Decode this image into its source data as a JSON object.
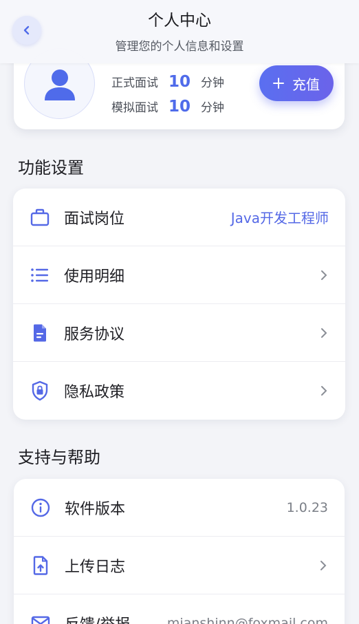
{
  "header": {
    "title": "个人中心",
    "subtitle": "管理您的个人信息和设置"
  },
  "profile": {
    "quota": [
      {
        "label": "正式面试",
        "value": "10",
        "unit": "分钟"
      },
      {
        "label": "模拟面试",
        "value": "10",
        "unit": "分钟"
      }
    ],
    "recharge_label": "充值",
    "recharge_icon": "plus-icon"
  },
  "settings": {
    "title": "功能设置",
    "items": [
      {
        "label": "面试岗位",
        "value": "Java开发工程师",
        "icon": "briefcase-icon"
      },
      {
        "label": "使用明细",
        "icon": "list-icon"
      },
      {
        "label": "服务协议",
        "icon": "document-icon"
      },
      {
        "label": "隐私政策",
        "icon": "shield-lock-icon"
      }
    ]
  },
  "support": {
    "title": "支持与帮助",
    "items": [
      {
        "label": "软件版本",
        "value": "1.0.23",
        "icon": "info-icon"
      },
      {
        "label": "上传日志",
        "icon": "upload-file-icon"
      },
      {
        "label": "反馈/举报",
        "value": "mianshinn@foxmail.com",
        "icon": "mail-icon"
      }
    ]
  },
  "colors": {
    "accent": "#5468e6",
    "background": "#f3f4f8",
    "card": "#ffffff"
  }
}
